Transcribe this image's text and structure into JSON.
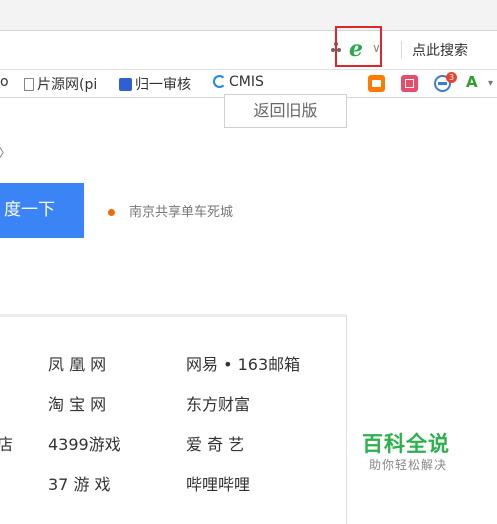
{
  "toolbar": {
    "search_link": "点此搜索"
  },
  "bookmarks": [
    {
      "label": "o"
    },
    {
      "label": "片源网(pi"
    },
    {
      "label": "归一审核"
    },
    {
      "label": "CMIS"
    }
  ],
  "extensions": {
    "badge_count": "3"
  },
  "page": {
    "old_version": "返回旧版",
    "search_button": "度一下",
    "hot_topic": "南京共享单车死城"
  },
  "nav": {
    "rows": [
      [
        "凤 凰 网",
        "网易 • 163邮箱"
      ],
      [
        "淘 宝 网",
        "东方财富"
      ],
      [
        "4399游戏",
        "爱 奇 艺"
      ],
      [
        "37 游 戏",
        "哔哩哔哩"
      ]
    ],
    "left_partial": "店"
  },
  "watermark": {
    "title": "百科全说",
    "subtitle": "助你轻松解决"
  },
  "colors": {
    "highlight_border": "#e0262a",
    "ie_green": "#2aa84a",
    "search_blue": "#3a84f5",
    "hot_dot": "#f56a00",
    "watermark_green": "#2bb24c"
  }
}
